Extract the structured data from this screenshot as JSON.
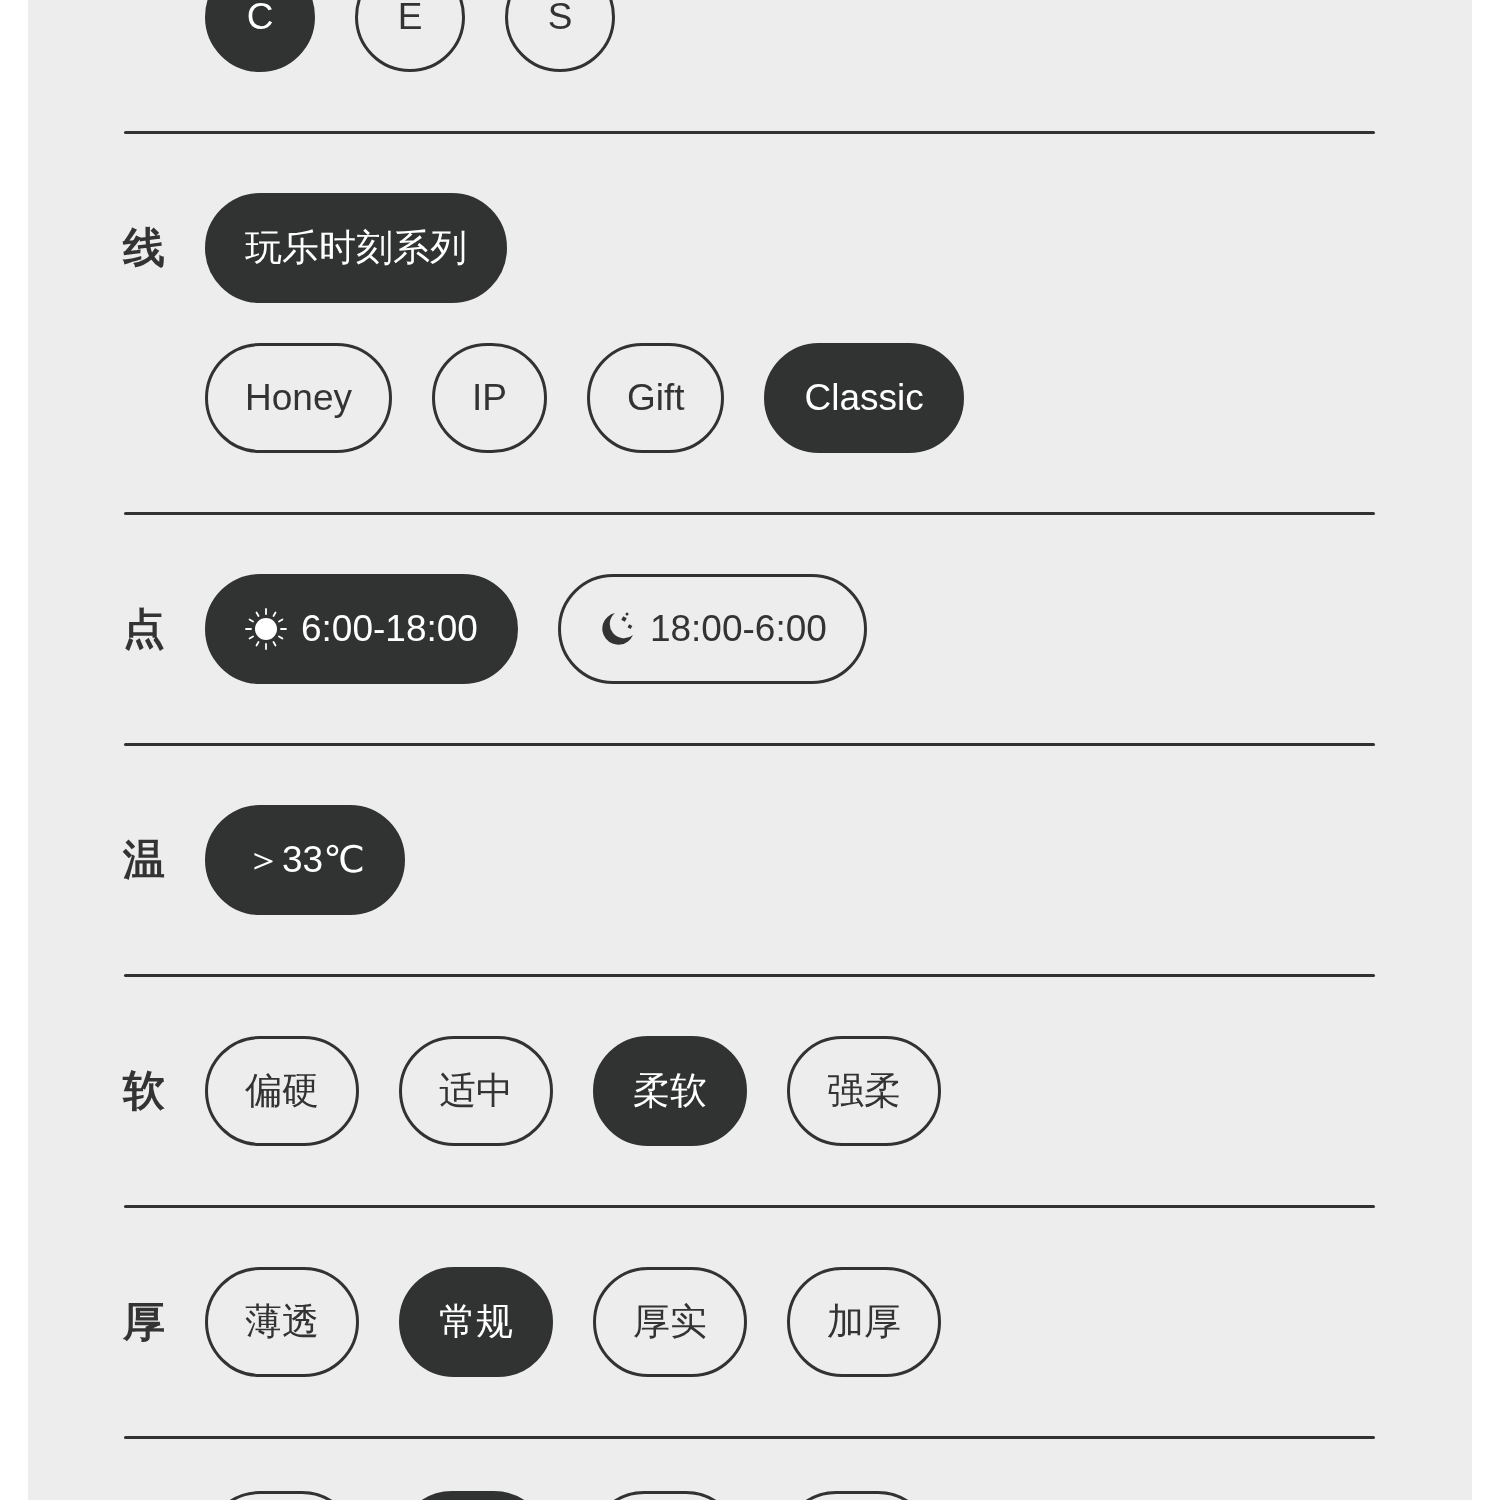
{
  "sections": [
    {
      "option_rows": [
        [
          {
            "label": "C",
            "selected": true
          },
          {
            "label": "E",
            "selected": false
          },
          {
            "label": "S",
            "selected": false
          }
        ]
      ]
    },
    {
      "label": "线",
      "option_rows": [
        [
          {
            "label": "玩乐时刻系列",
            "selected": true
          }
        ],
        [
          {
            "label": "Honey",
            "selected": false
          },
          {
            "label": "IP",
            "selected": false
          },
          {
            "label": "Gift",
            "selected": false
          },
          {
            "label": "Classic",
            "selected": true
          }
        ]
      ]
    },
    {
      "label": "点",
      "option_rows": [
        [
          {
            "kind": "day",
            "label": "6:00-18:00",
            "selected": true
          },
          {
            "kind": "night",
            "label": "18:00-6:00",
            "selected": false
          }
        ]
      ]
    },
    {
      "label": "温",
      "option_rows": [
        [
          {
            "label": "＞33℃",
            "selected": true
          }
        ]
      ]
    },
    {
      "label": "软",
      "option_rows": [
        [
          {
            "label": "偏硬",
            "selected": false
          },
          {
            "label": "适中",
            "selected": false
          },
          {
            "label": "柔软",
            "selected": true
          },
          {
            "label": "强柔",
            "selected": false
          }
        ]
      ]
    },
    {
      "label": "厚",
      "option_rows": [
        [
          {
            "label": "薄透",
            "selected": false
          },
          {
            "label": "常规",
            "selected": true
          },
          {
            "label": "厚实",
            "selected": false
          },
          {
            "label": "加厚",
            "selected": false
          }
        ]
      ]
    },
    {
      "option_rows": [
        [
          {
            "selected": false
          },
          {
            "selected": true
          },
          {
            "selected": false
          },
          {
            "selected": false
          }
        ]
      ]
    }
  ]
}
